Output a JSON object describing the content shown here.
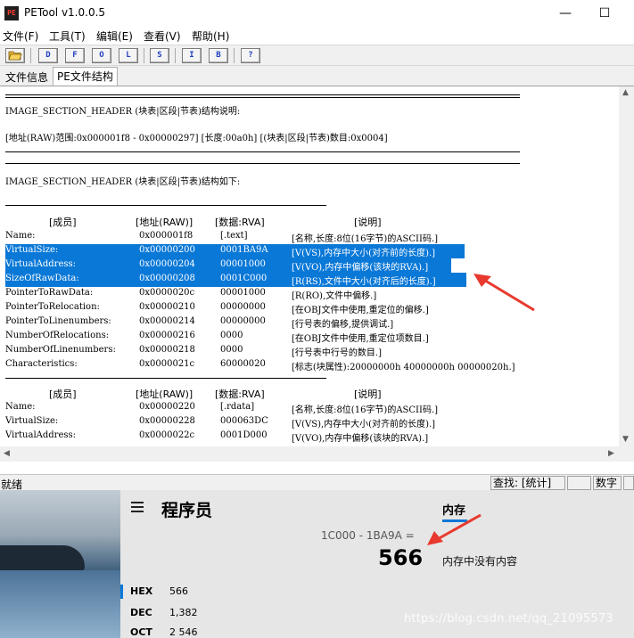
{
  "window": {
    "title": "PETool v1.0.0.5",
    "icon_text": "PE",
    "minimize_glyph": "—",
    "maximize_glyph": "☐",
    "close_glyph": "✕"
  },
  "menu": [
    "文件(F)",
    "工具(T)",
    "编辑(E)",
    "查看(V)",
    "帮助(H)"
  ],
  "toolbar": {
    "open_icon": "folder-open-icon",
    "buttons": [
      "D",
      "F",
      "O",
      "L",
      "S",
      "I",
      "B",
      "?"
    ]
  },
  "tabs": [
    {
      "label": "文件信息",
      "active": false
    },
    {
      "label": "PE文件结构",
      "active": true
    }
  ],
  "content": {
    "desc_title": "IMAGE_SECTION_HEADER (块表|区段|节表)结构说明:",
    "address_line": "[地址(RAW)范围:0x000001f8 - 0x00000297] [长度:00a0h] [(块表|区段|节表)数目:0x0004]",
    "struct_title": "IMAGE_SECTION_HEADER (块表|区段|节表)结构如下:",
    "columns": [
      "[成员]",
      "[地址(RAW)]",
      "[数据:RVA]",
      "[说明]"
    ],
    "section1": [
      {
        "name": "Name:",
        "addr": "0x000001f8",
        "data": "[.text]",
        "desc": "[名称,长度:8位(16字节)的ASCII码.]",
        "selected": false
      },
      {
        "name": "VirtualSize:",
        "addr": "0x00000200",
        "data": "0001BA9A",
        "desc": "[V(VS),内存中大小(对齐前的长度).]",
        "selected": true
      },
      {
        "name": "VirtualAddress:",
        "addr": "0x00000204",
        "data": "00001000",
        "desc": "[V(VO),内存中偏移(该块的RVA).]",
        "selected": true
      },
      {
        "name": "SizeOfRawData:",
        "addr": "0x00000208",
        "data": "0001C000",
        "desc": "[R(RS),文件中大小(对齐后的长度).]",
        "selected": true
      },
      {
        "name": "PointerToRawData:",
        "addr": "0x0000020c",
        "data": "00001000",
        "desc": "[R(RO),文件中偏移.]",
        "selected": false
      },
      {
        "name": "PointerToRelocation:",
        "addr": "0x00000210",
        "data": "00000000",
        "desc": "[在OBJ文件中使用,重定位的偏移.]",
        "selected": false
      },
      {
        "name": "PointerToLinenumbers:",
        "addr": "0x00000214",
        "data": "00000000",
        "desc": "[行号表的偏移,提供调试.]",
        "selected": false
      },
      {
        "name": "NumberOfRelocations:",
        "addr": "0x00000216",
        "data": "0000",
        "desc": "[在OBJ文件中使用,重定位项数目.]",
        "selected": false
      },
      {
        "name": "NumberOfLinenumbers:",
        "addr": "0x00000218",
        "data": "0000",
        "desc": "[行号表中行号的数目.]",
        "selected": false
      },
      {
        "name": "Characteristics:",
        "addr": "0x0000021c",
        "data": "60000020",
        "desc": "[标志(块属性):20000000h 40000000h 00000020h.]",
        "selected": false
      }
    ],
    "section2": [
      {
        "name": "Name:",
        "addr": "0x00000220",
        "data": "[.rdata]",
        "desc": "[名称,长度:8位(16字节)的ASCII码.]"
      },
      {
        "name": "VirtualSize:",
        "addr": "0x00000228",
        "data": "000063DC",
        "desc": "[V(VS),内存中大小(对齐前的长度).]"
      },
      {
        "name": "VirtualAddress:",
        "addr": "0x0000022c",
        "data": "0001D000",
        "desc": "[V(VO),内存中偏移(该块的RVA).]"
      }
    ]
  },
  "statusbar": {
    "ready": "就绪",
    "find": "查找: [统计]",
    "num": "数字"
  },
  "calculator": {
    "title": "程序员",
    "memory_tab": "内存",
    "expression": "1C000 - 1BA9A =",
    "result": "566",
    "memory_empty": "内存中没有内容",
    "bases": [
      {
        "label": "HEX",
        "value": "566"
      },
      {
        "label": "DEC",
        "value": "1,382"
      },
      {
        "label": "OCT",
        "value": "2 546"
      }
    ],
    "watermark": "https://blog.csdn.net/qq_21095573"
  },
  "colors": {
    "selection": "#0a78d7",
    "annotation_arrow": "#e8392e"
  }
}
